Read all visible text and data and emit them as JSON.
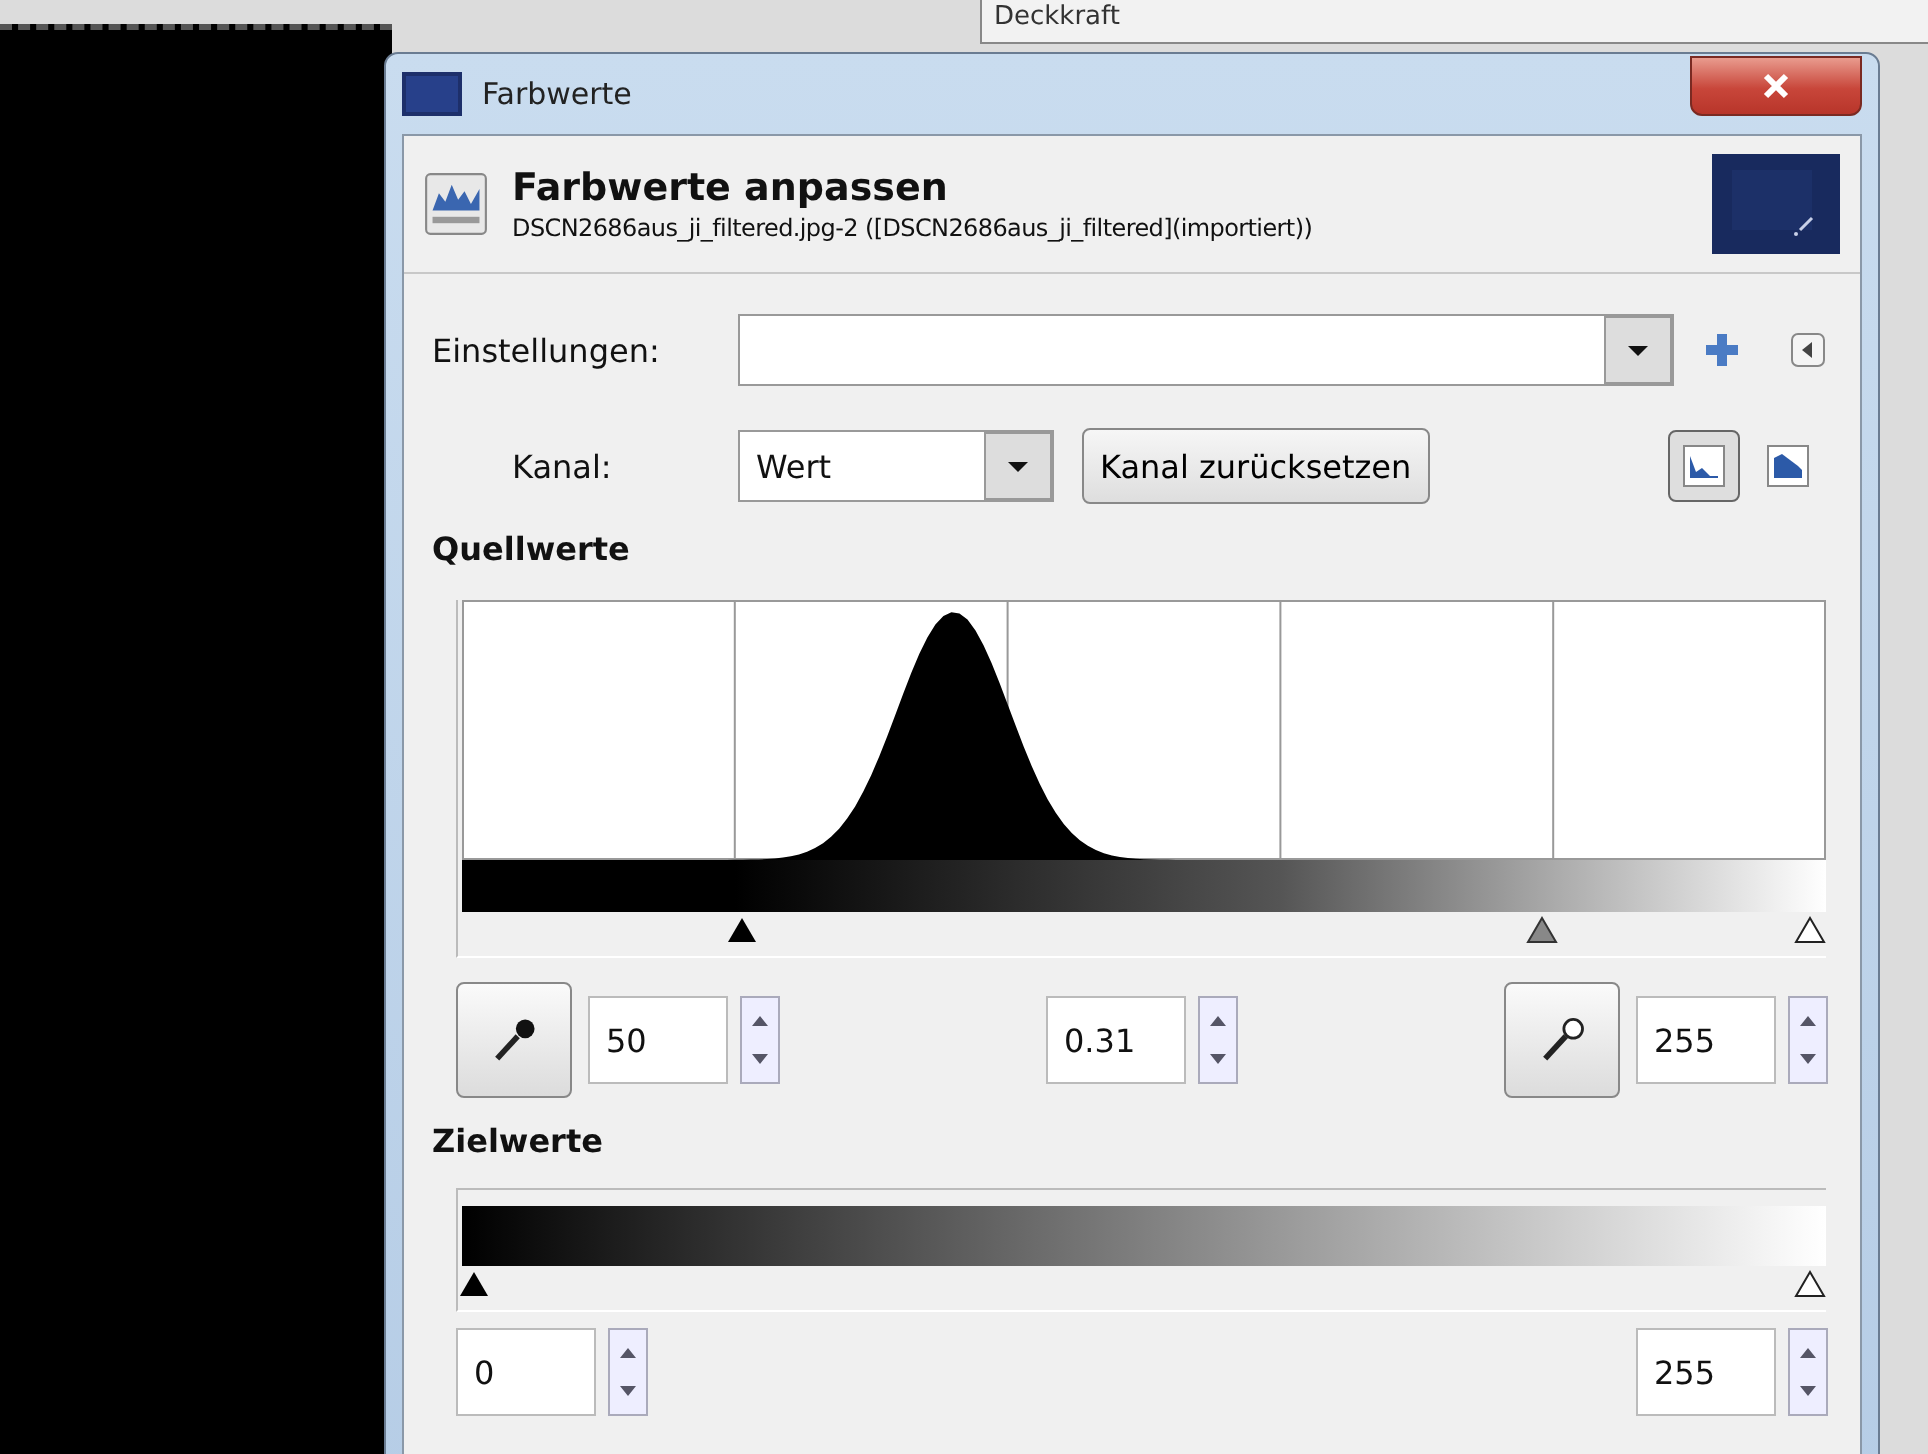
{
  "background": {
    "field_label": "Deckkraft"
  },
  "window": {
    "title": "Farbwerte"
  },
  "header": {
    "title": "Farbwerte anpassen",
    "subtitle": "DSCN2686aus_ji_filtered.jpg-2 ([DSCN2686aus_ji_filtered](importiert))"
  },
  "settings": {
    "label": "Einstellungen:"
  },
  "channel": {
    "label": "Kanal:",
    "value": "Wert",
    "reset_button": "Kanal zurücksetzen",
    "views": [
      {
        "kind": "linear",
        "selected": true
      },
      {
        "kind": "logarithmic",
        "selected": false
      }
    ]
  },
  "input_levels": {
    "title": "Quellwerte",
    "sliders": [
      {
        "kind": "black",
        "level": 0.2
      },
      {
        "kind": "gray",
        "level": 0.8
      },
      {
        "kind": "white",
        "level": 1
      }
    ],
    "low": "50",
    "gamma": "0.31",
    "high": "255"
  },
  "output_levels": {
    "title": "Zielwerte",
    "sliders": [
      {
        "kind": "black",
        "level": 0
      },
      {
        "kind": "white",
        "level": 1
      }
    ],
    "low": "0",
    "high": "255"
  }
}
